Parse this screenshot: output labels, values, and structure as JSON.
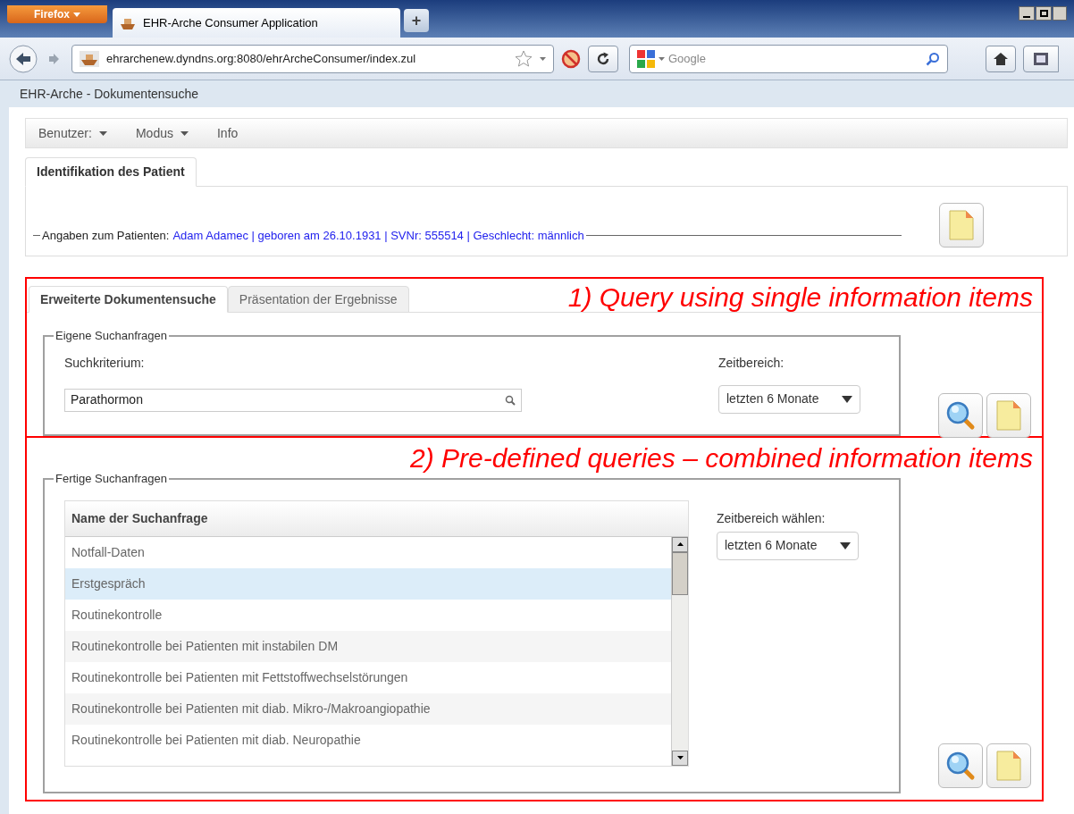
{
  "browser": {
    "menu_button": "Firefox",
    "tab_title": "EHR-Arche Consumer Application",
    "new_tab": "+",
    "url": "ehrarchenew.dyndns.org:8080/ehrArcheConsumer/index.zul",
    "search_placeholder": "Google"
  },
  "app_title": "EHR-Arche - Dokumentensuche",
  "menu": [
    {
      "label": "Benutzer:",
      "has_dropdown": true
    },
    {
      "label": "Modus",
      "has_dropdown": true
    },
    {
      "label": "Info",
      "has_dropdown": false
    }
  ],
  "patient_tabs": [
    {
      "label": "Identifikation des Patient",
      "selected": true
    }
  ],
  "patient_group": {
    "legend": "Angaben zum Patienten:",
    "info": "Adam Adamec | geboren am 26.10.1931 | SVNr: 555514 | Geschlecht: männlich"
  },
  "search_tabs": [
    {
      "label": "Erweiterte Dokumentensuche",
      "selected": true
    },
    {
      "label": "Präsentation der Ergebnisse",
      "selected": false
    }
  ],
  "annotations": [
    "1) Query using single information items",
    "2) Pre-defined queries – combined information items"
  ],
  "own_queries": {
    "legend": "Eigene Suchanfragen",
    "criterion_label": "Suchkriterium:",
    "criterion_value": "Parathormon",
    "range_label": "Zeitbereich:",
    "range_value": "letzten 6 Monate"
  },
  "predefined_queries": {
    "legend": "Fertige Suchanfragen",
    "columns": [
      "Name der Suchanfrage"
    ],
    "rows": [
      {
        "name": "Notfall-Daten",
        "selected": false
      },
      {
        "name": "Erstgespräch",
        "selected": true
      },
      {
        "name": "Routinekontrolle",
        "selected": false
      },
      {
        "name": "Routinekontrolle bei Patienten mit instabilen DM",
        "selected": false
      },
      {
        "name": "Routinekontrolle bei Patienten mit Fettstoffwechselstörungen",
        "selected": false
      },
      {
        "name": "Routinekontrolle bei Patienten mit diab. Mikro-/Makroangiopathie",
        "selected": false
      },
      {
        "name": "Routinekontrolle bei Patienten mit diab. Neuropathie",
        "selected": false
      }
    ],
    "range_label": "Zeitbereich wählen:",
    "range_value": "letzten 6 Monate"
  }
}
